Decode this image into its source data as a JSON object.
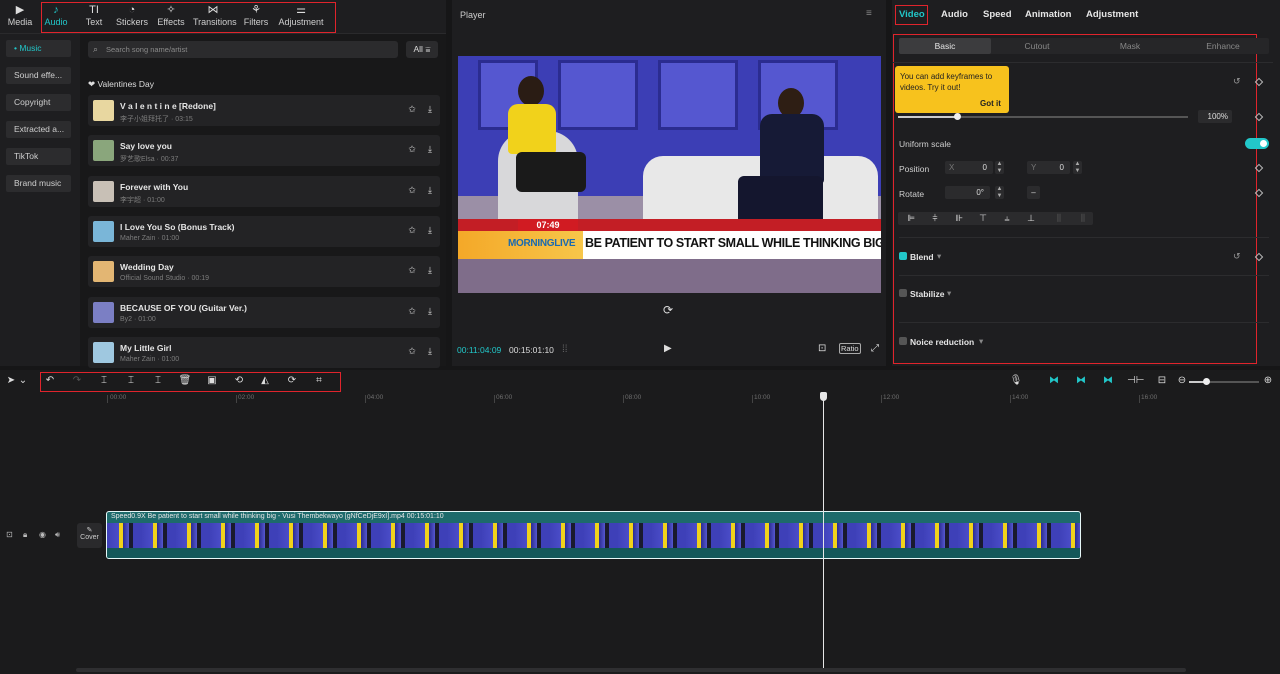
{
  "top_tabs": [
    {
      "label": "Media",
      "icon": "media-icon",
      "glyph": "▶"
    },
    {
      "label": "Audio",
      "icon": "audio-icon",
      "glyph": "♪"
    },
    {
      "label": "Text",
      "icon": "text-icon",
      "glyph": "TI"
    },
    {
      "label": "Stickers",
      "icon": "sticker-icon",
      "glyph": "◔"
    },
    {
      "label": "Effects",
      "icon": "effects-icon",
      "glyph": "✧"
    },
    {
      "label": "Transitions",
      "icon": "transitions-icon",
      "glyph": "⋈"
    },
    {
      "label": "Filters",
      "icon": "filters-icon",
      "glyph": "⚘"
    },
    {
      "label": "Adjustment",
      "icon": "adjustment-icon",
      "glyph": "⚌"
    }
  ],
  "categories": [
    "• Music",
    "Sound effe...",
    "Copyright",
    "Extracted a...",
    "TikTok",
    "Brand music"
  ],
  "search": {
    "placeholder": "Search song name/artist",
    "filter_label": "All"
  },
  "section_title": "❤ Valentines Day",
  "songs": [
    {
      "title": "V a l e n t i n e [Redone]",
      "meta": "李子小姐拜托了 · 03:15",
      "thumb": "#e8d7a0"
    },
    {
      "title": "Say love you",
      "meta": "罗艺歌Elsa · 00:37",
      "thumb": "#8aa67c"
    },
    {
      "title": "Forever with You",
      "meta": "李宇超 · 01:00",
      "thumb": "#c8c0b6"
    },
    {
      "title": "I Love You So (Bonus Track)",
      "meta": "Maher Zain · 01:00",
      "thumb": "#7ab6d8"
    },
    {
      "title": "Wedding Day",
      "meta": "Official Sound Studio · 00:19",
      "thumb": "#e3b673"
    },
    {
      "title": "BECAUSE OF YOU (Guitar Ver.)",
      "meta": "By2 · 01:00",
      "thumb": "#7b7fc4"
    },
    {
      "title": "My Little Girl",
      "meta": "Maher Zain · 01:00",
      "thumb": "#9fc8e0"
    }
  ],
  "player": {
    "title": "Player",
    "badge_time": "07:49",
    "logo": "MORNINGLIVE",
    "headline": "BE PATIENT TO START SMALL WHILE THINKING BIG",
    "time_current": "00:11:04:09",
    "time_total": "00:15:01:10",
    "ratio_label": "Ratio"
  },
  "right_tabs": [
    "Video",
    "Audio",
    "Speed",
    "Animation",
    "Adjustment"
  ],
  "sub_tabs": [
    "Basic",
    "Cutout",
    "Mask",
    "Enhance"
  ],
  "tooltip": {
    "message": "You can add keyframes to videos. Try it out!",
    "button": "Got it"
  },
  "basic": {
    "scale_value": "100%",
    "scale_fraction": 0.2,
    "uniform_scale_label": "Uniform scale",
    "position_label": "Position",
    "pos_x_prefix": "X",
    "pos_x": "0",
    "pos_y_prefix": "Y",
    "pos_y": "0",
    "rotate_label": "Rotate",
    "rotate_value": "0°",
    "blend_label": "Blend",
    "stabilize_label": "Stabilize",
    "noise_label": "Noice reduction"
  },
  "timeline": {
    "ticks": [
      "00:00",
      "02:00",
      "04:00",
      "06:00",
      "08:00",
      "10:00",
      "12:00",
      "14:00",
      "16:00"
    ],
    "cover_label": "Cover",
    "clip_label": "Speed0.9X  Be patient to start small while thinking big - Vusi Thembekwayo [gNfCeDjE9xI].mp4  00:15:01:10"
  },
  "colors": {
    "accent": "#22c7c9",
    "highlight": "#e0242c",
    "tooltip": "#f7c21d"
  }
}
